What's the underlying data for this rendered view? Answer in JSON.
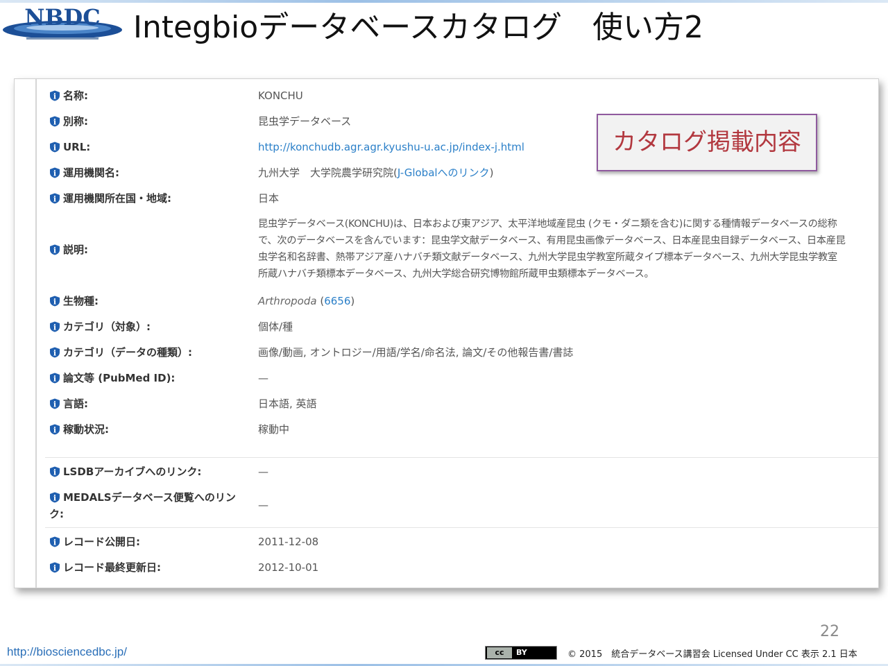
{
  "header": {
    "logo_text": "NBDC",
    "title": "Integbioデータベースカタログ　使い方2"
  },
  "callout": "カタログ掲載内容",
  "rows": {
    "name": {
      "label": "名称:",
      "value": "KONCHU"
    },
    "alias": {
      "label": "別称:",
      "value": "昆虫学データベース"
    },
    "url": {
      "label": "URL:",
      "value": "http://konchudb.agr.agr.kyushu-u.ac.jp/index-j.html"
    },
    "org": {
      "label": "運用機関名:",
      "value_prefix": "九州大学　大学院農学研究院(",
      "value_link": "J-Globalへのリンク",
      "value_suffix": ")"
    },
    "country": {
      "label": "運用機関所在国・地域:",
      "value": "日本"
    },
    "description": {
      "label": "説明:",
      "lines": [
        "昆虫学データベース(KONCHU)は、日本および東アジア、太平洋地域産昆虫 (クモ・ダニ類を含む)に関する種情報データベースの総称",
        "で、次のデータベースを含んでいます：昆虫学文献データベース、有用昆虫画像データベース、日本産昆虫目録データベース、日本産昆",
        "虫学名和名辞書、熱帯アジア産ハナバチ類文献データベース、九州大学昆虫学教室所蔵タイプ標本データベース、九州大学昆虫学教室",
        "所蔵ハナバチ類標本データベース、九州大学総合研究博物館所蔵甲虫類標本データベース。"
      ]
    },
    "species": {
      "label": "生物種:",
      "value_italic": "Arthropoda",
      "value_open": " (",
      "value_link": "6656",
      "value_close": ")"
    },
    "category_target": {
      "label": "カテゴリ（対象）:",
      "value": "個体/種"
    },
    "category_type": {
      "label": "カテゴリ（データの種類）:",
      "value": "画像/動画, オントロジー/用語/学名/命名法, 論文/その他報告書/書誌"
    },
    "pubmed": {
      "label": "論文等 (PubMed ID):",
      "value": "—"
    },
    "language": {
      "label": "言語:",
      "value": "日本語, 英語"
    },
    "status": {
      "label": "稼動状況:",
      "value": "稼動中"
    },
    "lsdb": {
      "label": "LSDBアーカイブへのリンク:",
      "value": "—"
    },
    "medals": {
      "label_line1": "MEDALSデータベース便覧へのリン",
      "label_line2": "ク:",
      "value": "—"
    },
    "published": {
      "label": "レコード公開日:",
      "value": "2011-12-08"
    },
    "updated": {
      "label": "レコード最終更新日:",
      "value": "2012-10-01"
    }
  },
  "footer": {
    "page_number": "22",
    "url": "http://biosciencedbc.jp/",
    "cc_left": "cc",
    "cc_right": "BY",
    "license": "© 2015　統合データベース講習会 Licensed Under CC 表示 2.1 日本"
  },
  "colors": {
    "link": "#2a7fc8",
    "info_icon": "#1f5fb0",
    "callout_text": "#b2383f",
    "callout_border": "#8f5a9e"
  }
}
